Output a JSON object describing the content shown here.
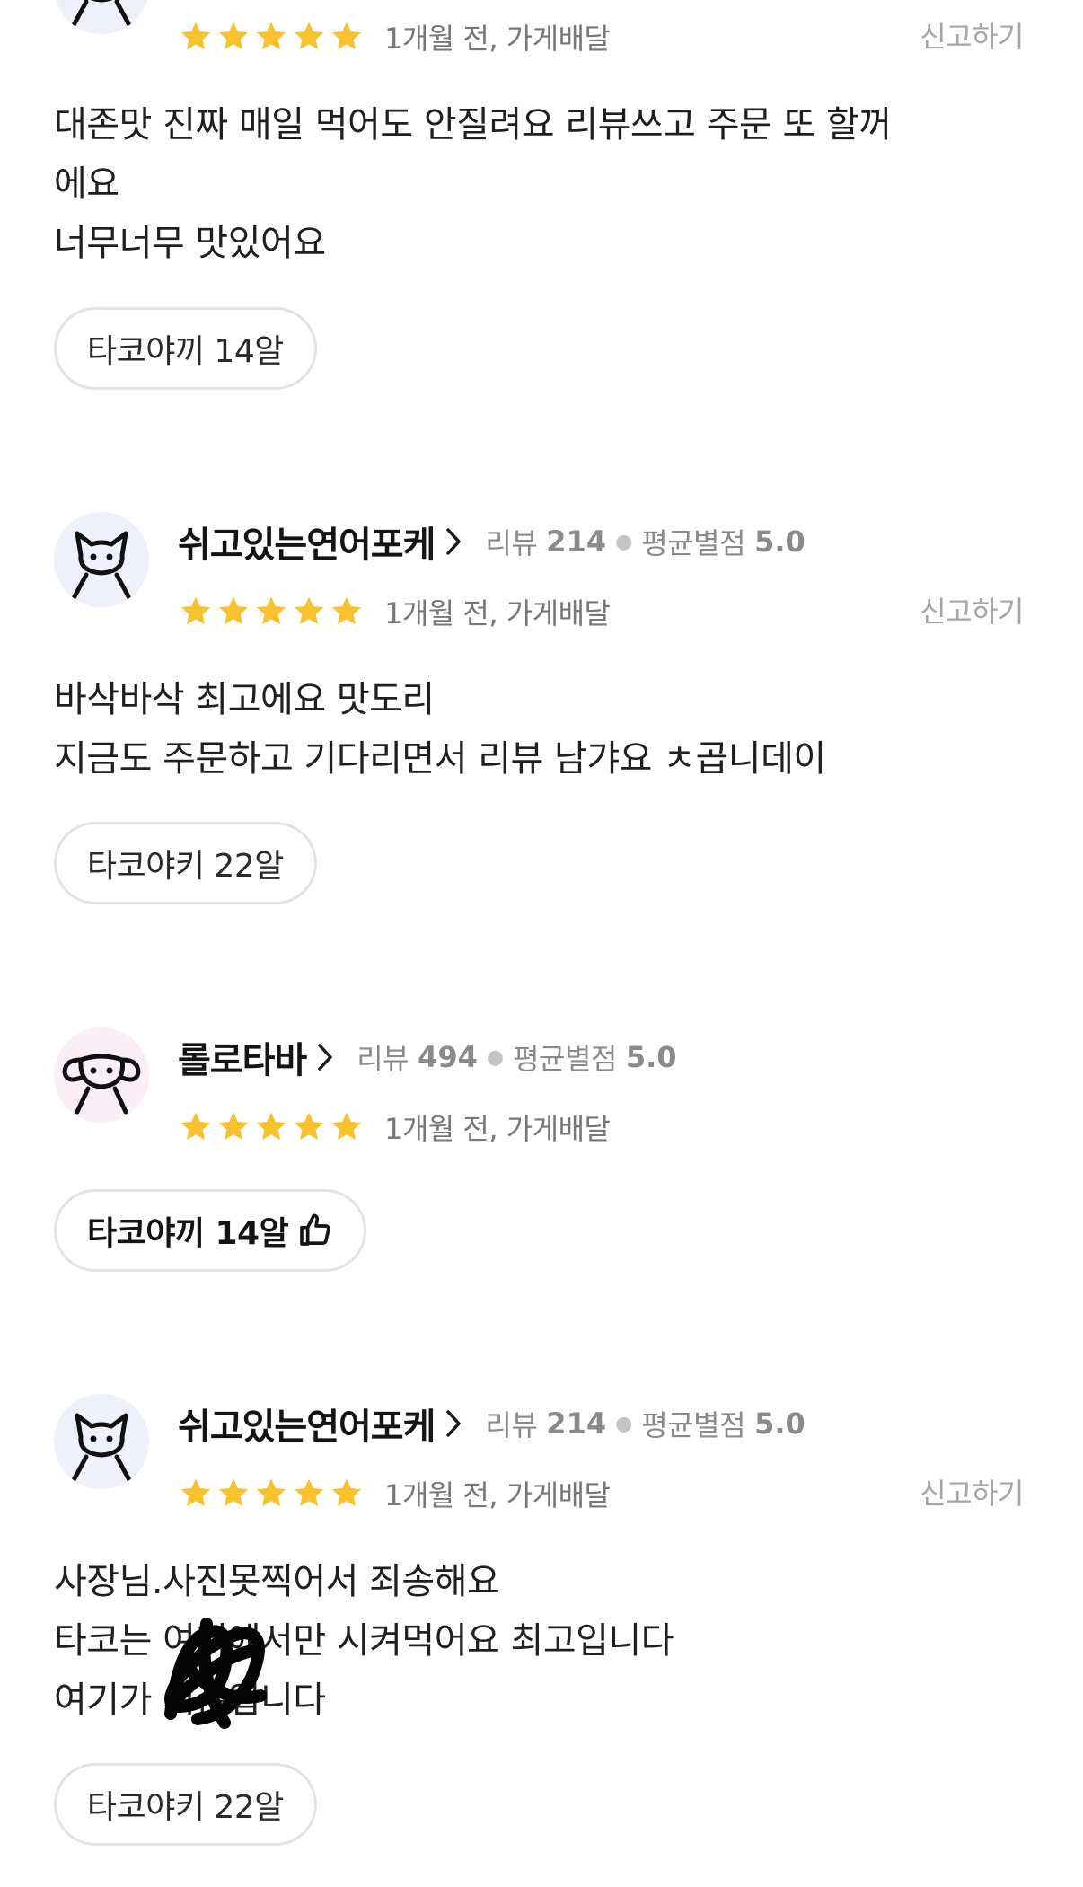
{
  "colors": {
    "star": "#f7c22e",
    "report": "#a6a6a6",
    "chip_border": "#e3e3e3"
  },
  "reviews": [
    {
      "rating": 5,
      "time": "1개월 전, 가게배달",
      "report": "신고하기",
      "text": "대존맛 진짜 매일 먹어도 안질려요 리뷰쓰고 주문 또 할꺼\n에요\n너무너무 맛있어요",
      "menu": "타코야끼 14알"
    },
    {
      "nickname": "쉬고있는연어포케",
      "avatar": "cat-avatar-icon",
      "review_label": "리뷰",
      "review_count": "214",
      "avg_label": "평균별점",
      "avg_rating": "5.0",
      "rating": 5,
      "time": "1개월 전, 가게배달",
      "report": "신고하기",
      "text": "바삭바삭 최고에요 맛도리\n지금도 주문하고 기다리면서 리뷰 남갸요 ㅊ곱니데이",
      "menu": "타코야키 22알"
    },
    {
      "nickname": "롤로타바",
      "avatar": "dog-avatar-icon",
      "review_label": "리뷰",
      "review_count": "494",
      "avg_label": "평균별점",
      "avg_rating": "5.0",
      "rating": 5,
      "time": "1개월 전, 가게배달",
      "menu": "타코야끼 14알",
      "menu_icon": "thumbs-up-icon"
    },
    {
      "nickname": "쉬고있는연어포케",
      "avatar": "cat-avatar-icon",
      "review_label": "리뷰",
      "review_count": "214",
      "avg_label": "평균별점",
      "avg_rating": "5.0",
      "rating": 5,
      "time": "1개월 전, 가게배달",
      "report": "신고하기",
      "text": "사장님.사진못찍어서 죄송해요\n타코는 여기에서만 시켜먹어요 최고입니다\n여기가 시존입니다",
      "menu": "타코야키 22알"
    }
  ]
}
